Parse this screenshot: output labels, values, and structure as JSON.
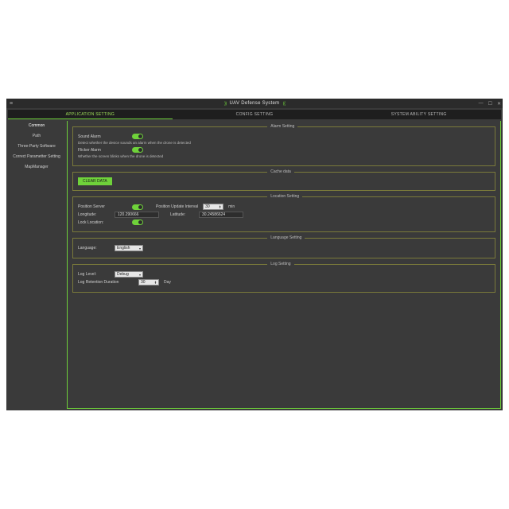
{
  "window": {
    "title": "UAV Defense System"
  },
  "tabs": {
    "app": "APPLICATION SETTING",
    "config": "CONFIG SETTING",
    "ability": "SYSTEM ABILITY SETTING"
  },
  "sidebar": {
    "items": [
      "Common",
      "Path",
      "Three-Party Software",
      "Correct Parametter Setting",
      "MapManager"
    ]
  },
  "groups": {
    "alarm": {
      "title": "Alarm Setting",
      "sound_label": "Sound Alarm",
      "sound_desc": "Detect whether the device sounds an alarm when the drone is detected",
      "flicker_label": "Flicker Alarm",
      "flicker_desc": "Whether the screen blinks when the drone is detected"
    },
    "cache": {
      "title": "Cache data",
      "clear_btn": "CLEAR DATA"
    },
    "location": {
      "title": "Location Setting",
      "pos_server": "Position Server",
      "update_label": "Position Update Interval",
      "update_value": "30",
      "update_unit": "min",
      "lng_label": "Longitude:",
      "lng_value": "120.290666",
      "lat_label": "Latitude:",
      "lat_value": "30.24586624",
      "lock_label": "Lock Location:"
    },
    "language": {
      "title": "Language Setting",
      "label": "Language:",
      "value": "English"
    },
    "log": {
      "title": "Log Setting",
      "level_label": "Log Level:",
      "level_value": "Debug",
      "retention_label": "Log Retention Duration",
      "retention_value": "30",
      "retention_unit": "Day"
    }
  }
}
